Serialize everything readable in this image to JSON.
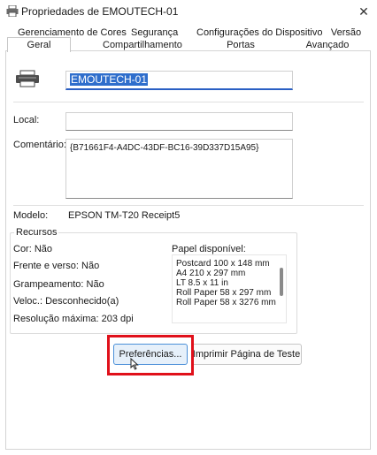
{
  "window": {
    "title": "Propriedades de EMOUTECH-01",
    "close_glyph": "✕"
  },
  "tabs": [
    {
      "label": "Gerenciamento de Cores"
    },
    {
      "label": "Segurança"
    },
    {
      "label": "Configurações do Dispositivo"
    },
    {
      "label": "Versão"
    },
    {
      "label": "Geral",
      "active": true
    },
    {
      "label": "Compartilhamento"
    },
    {
      "label": "Portas"
    },
    {
      "label": "Avançado"
    }
  ],
  "general": {
    "printer_name": "EMOUTECH-01",
    "location_label": "Local:",
    "location_value": "",
    "comment_label": "Comentário:",
    "comment_value": "{B71661F4-A4DC-43DF-BC16-39D337D15A95}",
    "model_label": "Modelo:",
    "model_value": "EPSON TM-T20 Receipt5"
  },
  "features": {
    "group_title": "Recursos",
    "color": "Cor: Não",
    "duplex": "Frente e verso: Não",
    "staple": "Grampeamento: Não",
    "speed": "Veloc.: Desconhecido(a)",
    "max_resolution": "Resolução máxima: 203 dpi",
    "paper_label": "Papel disponível:",
    "papers": [
      "Postcard 100 x 148 mm",
      "A4 210 x 297 mm",
      "LT 8.5 x 11 in",
      "Roll Paper 58 x 297 mm",
      "Roll Paper 58 x 3276 mm"
    ]
  },
  "buttons": {
    "preferences": "Preferências...",
    "print_test": "Imprimir Página de Teste"
  },
  "colors": {
    "highlight": "#e0101a",
    "selection": "#2f6ecc",
    "focus_border": "#4a8fd8"
  }
}
